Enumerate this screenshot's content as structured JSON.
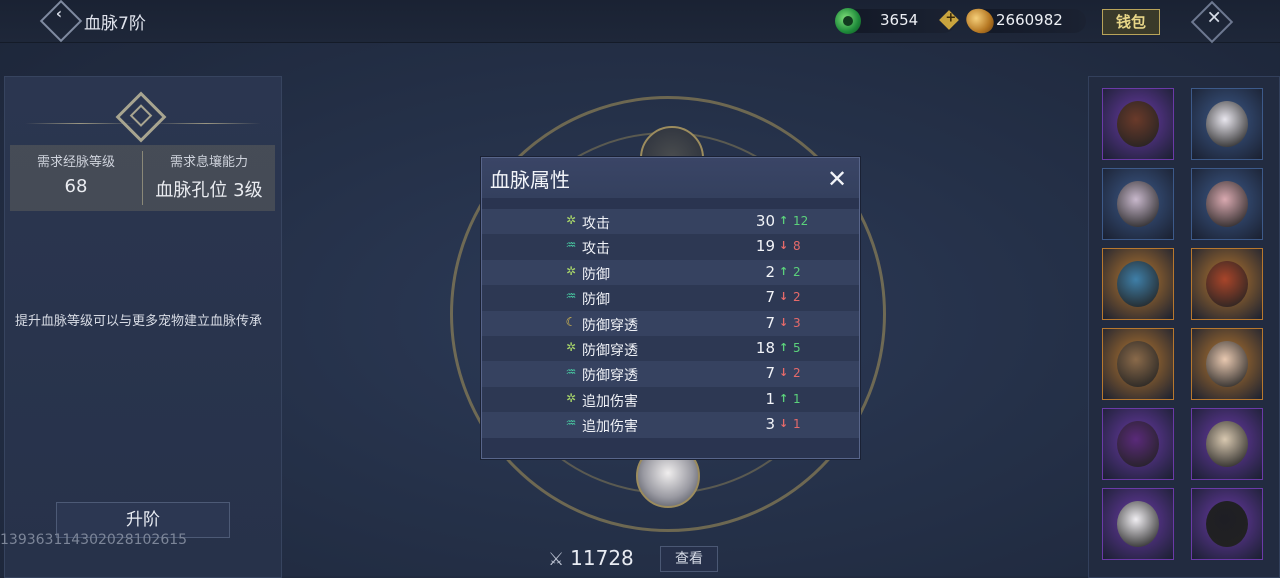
{
  "header": {
    "title": "血脉7阶",
    "currencies": [
      {
        "icon": "jade-icon",
        "value": "3654"
      },
      {
        "icon": "gold-coin-icon",
        "value": "2660982"
      }
    ],
    "wallet_label": "钱包"
  },
  "left_panel": {
    "requirements": [
      {
        "label": "需求经脉等级",
        "value": "68"
      },
      {
        "label": "需求息壤能力",
        "value": "血脉孔位 3级"
      }
    ],
    "description": "提升血脉等级可以与更多宠物建立血脉传承",
    "upgrade_label": "升阶",
    "watermark": "13936311430202810261​5"
  },
  "center": {
    "power": "11728",
    "view_label": "查看"
  },
  "modal": {
    "title": "血脉属性",
    "rows": [
      {
        "icon": "leaf-icon",
        "label": "攻击",
        "value": "30",
        "dir": "up",
        "delta": "12"
      },
      {
        "icon": "water-icon",
        "label": "攻击",
        "value": "19",
        "dir": "down",
        "delta": "8"
      },
      {
        "icon": "leaf-icon",
        "label": "防御",
        "value": "2",
        "dir": "up",
        "delta": "2"
      },
      {
        "icon": "water-icon",
        "label": "防御",
        "value": "7",
        "dir": "down",
        "delta": "2"
      },
      {
        "icon": "moon-icon",
        "label": "防御穿透",
        "value": "7",
        "dir": "down",
        "delta": "3"
      },
      {
        "icon": "leaf-icon",
        "label": "防御穿透",
        "value": "18",
        "dir": "up",
        "delta": "5"
      },
      {
        "icon": "water-icon",
        "label": "防御穿透",
        "value": "7",
        "dir": "down",
        "delta": "2"
      },
      {
        "icon": "leaf-icon",
        "label": "追加伤害",
        "value": "1",
        "dir": "up",
        "delta": "1"
      },
      {
        "icon": "water-icon",
        "label": "追加伤害",
        "value": "3",
        "dir": "down",
        "delta": "1"
      }
    ]
  },
  "pets": [
    {
      "name": "dark-warrior-portrait",
      "frame": "#6b3aa8",
      "color": "#6a3a2a"
    },
    {
      "name": "white-bunny-portrait",
      "frame": "#3d5a8a",
      "color": "#e8e6ee"
    },
    {
      "name": "pink-dragon-portrait",
      "frame": "#3d5a8a",
      "color": "#c8b8cc"
    },
    {
      "name": "pink-fox-portrait",
      "frame": "#3d5a8a",
      "color": "#d9a9b0"
    },
    {
      "name": "blue-scorpion-portrait",
      "frame": "#b8782e",
      "color": "#3f7fa8"
    },
    {
      "name": "red-crab-portrait",
      "frame": "#b8782e",
      "color": "#a8452a"
    },
    {
      "name": "mantis-portrait",
      "frame": "#b8782e",
      "color": "#8a6a4a"
    },
    {
      "name": "doll-portrait",
      "frame": "#b8782e",
      "color": "#e8c8b0"
    },
    {
      "name": "purple-beast-portrait",
      "frame": "#6b3aa8",
      "color": "#5a2a7a"
    },
    {
      "name": "tiger-portrait",
      "frame": "#6b3aa8",
      "color": "#d8c8b0"
    },
    {
      "name": "white-fluff-portrait",
      "frame": "#6b3aa8",
      "color": "#f0eef2"
    },
    {
      "name": "black-ox-portrait",
      "frame": "#6b3aa8",
      "color": "#1e1e24"
    }
  ]
}
